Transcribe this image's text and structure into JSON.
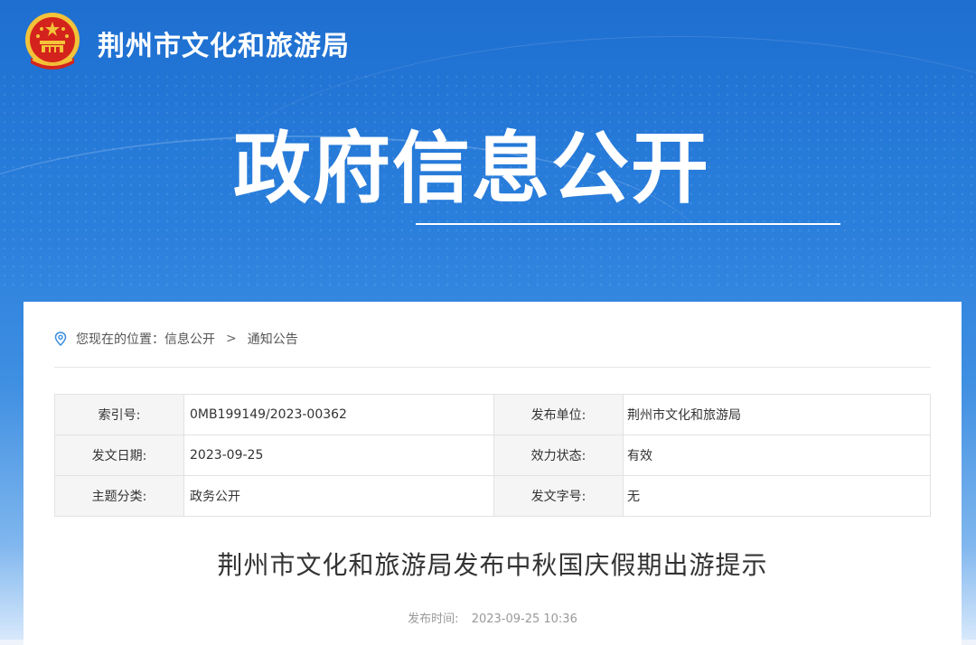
{
  "header": {
    "site_title": "荆州市文化和旅游局",
    "hero_title": "政府信息公开",
    "emblem_icon": "national-emblem-icon"
  },
  "breadcrumb": {
    "prefix": "您现在的位置：",
    "items": [
      "信息公开",
      "通知公告"
    ],
    "separator": ">"
  },
  "meta": {
    "rows": [
      {
        "k1": "索引号:",
        "v1": "0MB199149/2023-00362",
        "k2": "发布单位:",
        "v2": "荆州市文化和旅游局"
      },
      {
        "k1": "发文日期:",
        "v1": "2023-09-25",
        "k2": "效力状态:",
        "v2": "有效"
      },
      {
        "k1": "主题分类:",
        "v1": "政务公开",
        "k2": "发文字号:",
        "v2": "无"
      }
    ]
  },
  "article": {
    "title": "荆州市文化和旅游局发布中秋国庆假期出游提示",
    "pub_label": "发布时间:",
    "pub_time": "2023-09-25 10:36"
  },
  "colors": {
    "banner_top": "#1e6fd0",
    "emblem_red": "#d4231c",
    "emblem_gold": "#f3c339"
  }
}
